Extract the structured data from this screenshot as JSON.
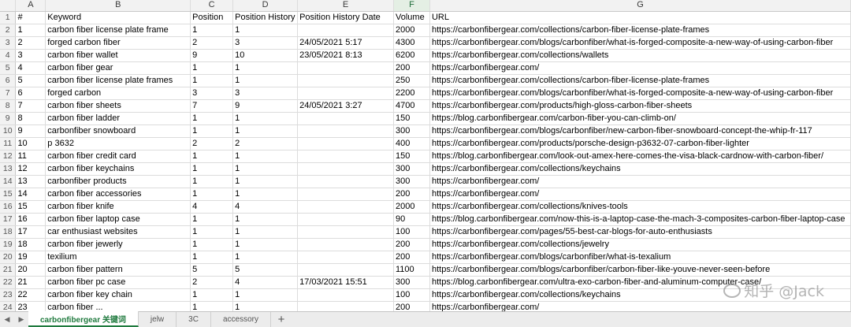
{
  "colors": {
    "active_tab": "#1f7a3e",
    "header_bg": "#f2f2f2",
    "gridline": "#dcdcdc"
  },
  "column_letters": [
    "A",
    "B",
    "C",
    "D",
    "E",
    "F",
    "G"
  ],
  "rows": [
    [
      "#",
      "Keyword",
      "Position",
      "Position History",
      "Position History Date",
      "Volume",
      "URL"
    ],
    [
      "1",
      "carbon fiber license plate frame",
      "1",
      "1",
      "",
      "2000",
      "https://carbonfibergear.com/collections/carbon-fiber-license-plate-frames"
    ],
    [
      "2",
      "forged carbon fiber",
      "2",
      "3",
      "24/05/2021 5:17",
      "4300",
      "https://carbonfibergear.com/blogs/carbonfiber/what-is-forged-composite-a-new-way-of-using-carbon-fiber"
    ],
    [
      "3",
      "carbon fiber wallet",
      "9",
      "10",
      "23/05/2021 8:13",
      "6200",
      "https://carbonfibergear.com/collections/wallets"
    ],
    [
      "4",
      "carbon fiber gear",
      "1",
      "1",
      "",
      "200",
      "https://carbonfibergear.com/"
    ],
    [
      "5",
      "carbon fiber license plate frames",
      "1",
      "1",
      "",
      "250",
      "https://carbonfibergear.com/collections/carbon-fiber-license-plate-frames"
    ],
    [
      "6",
      "forged carbon",
      "3",
      "3",
      "",
      "2200",
      "https://carbonfibergear.com/blogs/carbonfiber/what-is-forged-composite-a-new-way-of-using-carbon-fiber"
    ],
    [
      "7",
      "carbon fiber sheets",
      "7",
      "9",
      "24/05/2021 3:27",
      "4700",
      "https://carbonfibergear.com/products/high-gloss-carbon-fiber-sheets"
    ],
    [
      "8",
      "carbon fiber ladder",
      "1",
      "1",
      "",
      "150",
      "https://blog.carbonfibergear.com/carbon-fiber-you-can-climb-on/"
    ],
    [
      "9",
      "carbonfiber snowboard",
      "1",
      "1",
      "",
      "300",
      "https://carbonfibergear.com/blogs/carbonfiber/new-carbon-fiber-snowboard-concept-the-whip-fr-117"
    ],
    [
      "10",
      "p 3632",
      "2",
      "2",
      "",
      "400",
      "https://carbonfibergear.com/products/porsche-design-p3632-07-carbon-fiber-lighter"
    ],
    [
      "11",
      "carbon fiber credit card",
      "1",
      "1",
      "",
      "150",
      "https://blog.carbonfibergear.com/look-out-amex-here-comes-the-visa-black-cardnow-with-carbon-fiber/"
    ],
    [
      "12",
      "carbon fiber keychains",
      "1",
      "1",
      "",
      "300",
      "https://carbonfibergear.com/collections/keychains"
    ],
    [
      "13",
      "carbonfiber products",
      "1",
      "1",
      "",
      "300",
      "https://carbonfibergear.com/"
    ],
    [
      "14",
      "carbon fiber accessories",
      "1",
      "1",
      "",
      "200",
      "https://carbonfibergear.com/"
    ],
    [
      "15",
      "carbon fiber knife",
      "4",
      "4",
      "",
      "2000",
      "https://carbonfibergear.com/collections/knives-tools"
    ],
    [
      "16",
      "carbon fiber laptop case",
      "1",
      "1",
      "",
      "90",
      "https://blog.carbonfibergear.com/now-this-is-a-laptop-case-the-mach-3-composites-carbon-fiber-laptop-case"
    ],
    [
      "17",
      "car enthusiast websites",
      "1",
      "1",
      "",
      "100",
      "https://carbonfibergear.com/pages/55-best-car-blogs-for-auto-enthusiasts"
    ],
    [
      "18",
      "carbon fiber jewerly",
      "1",
      "1",
      "",
      "200",
      "https://carbonfibergear.com/collections/jewelry"
    ],
    [
      "19",
      "texilium",
      "1",
      "1",
      "",
      "200",
      "https://carbonfibergear.com/blogs/carbonfiber/what-is-texalium"
    ],
    [
      "20",
      "carbon fiber pattern",
      "5",
      "5",
      "",
      "1100",
      "https://carbonfibergear.com/blogs/carbonfiber/carbon-fiber-like-youve-never-seen-before"
    ],
    [
      "21",
      "carbon fiber pc case",
      "2",
      "4",
      "17/03/2021 15:51",
      "300",
      "https://blog.carbonfibergear.com/ultra-exo-carbon-fiber-and-aluminum-computer-case/"
    ],
    [
      "22",
      "carbon fiber key chain",
      "1",
      "1",
      "",
      "100",
      "https://carbonfibergear.com/collections/keychains"
    ],
    [
      "23",
      "carbon fiber ...",
      "1",
      "1",
      "",
      "200",
      "https://carbonfibergear.com/"
    ]
  ],
  "watermark_text": "知乎 @Jack",
  "tabs": [
    {
      "label": "carbonfibergear 关键词",
      "active": true
    },
    {
      "label": "jelw",
      "active": false
    },
    {
      "label": "3C",
      "active": false
    },
    {
      "label": "accessory",
      "active": false
    }
  ],
  "add_tab_label": "+",
  "nav_prev": "◀",
  "nav_next": "▶"
}
